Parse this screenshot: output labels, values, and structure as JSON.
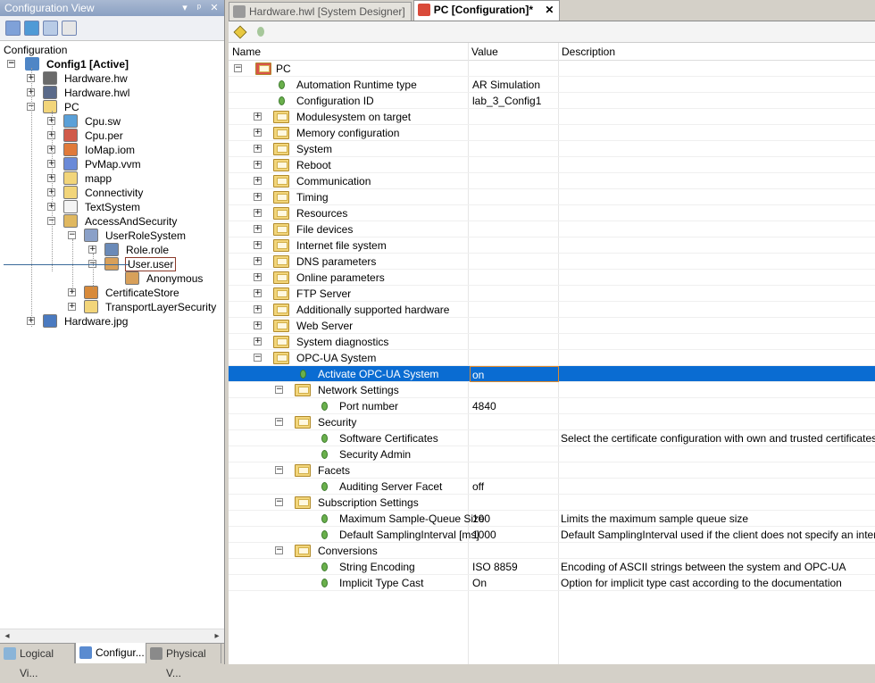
{
  "left_panel": {
    "title": "Configuration View",
    "title_buttons": [
      "▾",
      "ᵖ",
      "✕"
    ],
    "section_label": "Configuration",
    "root": "Config1 [Active]",
    "tree": [
      {
        "label": "Hardware.hw",
        "icon": "hardware-icon"
      },
      {
        "label": "Hardware.hwl",
        "icon": "hardware-list-icon"
      },
      {
        "label": "PC",
        "icon": "folder-icon"
      },
      {
        "label": "Cpu.sw",
        "icon": "software-icon"
      },
      {
        "label": "Cpu.per",
        "icon": "permission-icon"
      },
      {
        "label": "IoMap.iom",
        "icon": "iomap-icon"
      },
      {
        "label": "PvMap.vvm",
        "icon": "pvmap-icon"
      },
      {
        "label": "mapp",
        "icon": "folder-icon"
      },
      {
        "label": "Connectivity",
        "icon": "folder-icon"
      },
      {
        "label": "TextSystem",
        "icon": "text-icon"
      },
      {
        "label": "AccessAndSecurity",
        "icon": "shield-folder-icon"
      },
      {
        "label": "UserRoleSystem",
        "icon": "user-role-folder-icon"
      },
      {
        "label": "Role.role",
        "icon": "role-icon"
      },
      {
        "label": "User.user",
        "icon": "user-icon"
      },
      {
        "label": "Anonymous",
        "icon": "user-icon"
      },
      {
        "label": "CertificateStore",
        "icon": "certificate-icon"
      },
      {
        "label": "TransportLayerSecurity",
        "icon": "folder-icon"
      },
      {
        "label": "Hardware.jpg",
        "icon": "image-icon"
      }
    ],
    "bottom_tabs": [
      "Logical Vi...",
      "Configur...",
      "Physical V..."
    ]
  },
  "document_tabs": [
    {
      "label": "Hardware.hwl [System Designer]",
      "active": false
    },
    {
      "label": "PC [Configuration]*",
      "active": true,
      "close": "✕"
    }
  ],
  "grid": {
    "columns": [
      "Name",
      "Value",
      "Description"
    ],
    "root": "PC",
    "rows": [
      {
        "name": "Automation Runtime type",
        "value": "AR Simulation",
        "desc": "",
        "kind": "leaf",
        "level": 1
      },
      {
        "name": "Configuration ID",
        "value": "lab_3_Config1",
        "desc": "",
        "kind": "leaf",
        "level": 1
      },
      {
        "name": "Modulesystem on target",
        "value": "",
        "desc": "",
        "kind": "folder",
        "level": 1
      },
      {
        "name": "Memory configuration",
        "value": "",
        "desc": "",
        "kind": "folder",
        "level": 1
      },
      {
        "name": "System",
        "value": "",
        "desc": "",
        "kind": "folder",
        "level": 1
      },
      {
        "name": "Reboot",
        "value": "",
        "desc": "",
        "kind": "folder",
        "level": 1
      },
      {
        "name": "Communication",
        "value": "",
        "desc": "",
        "kind": "folder",
        "level": 1
      },
      {
        "name": "Timing",
        "value": "",
        "desc": "",
        "kind": "folder",
        "level": 1
      },
      {
        "name": "Resources",
        "value": "",
        "desc": "",
        "kind": "folder",
        "level": 1
      },
      {
        "name": "File devices",
        "value": "",
        "desc": "",
        "kind": "folder",
        "level": 1
      },
      {
        "name": "Internet file system",
        "value": "",
        "desc": "",
        "kind": "folder",
        "level": 1
      },
      {
        "name": "DNS parameters",
        "value": "",
        "desc": "",
        "kind": "folder",
        "level": 1
      },
      {
        "name": "Online parameters",
        "value": "",
        "desc": "",
        "kind": "folder",
        "level": 1
      },
      {
        "name": "FTP Server",
        "value": "",
        "desc": "",
        "kind": "folder",
        "level": 1
      },
      {
        "name": "Additionally supported hardware",
        "value": "",
        "desc": "",
        "kind": "folder",
        "level": 1
      },
      {
        "name": "Web Server",
        "value": "",
        "desc": "",
        "kind": "folder",
        "level": 1
      },
      {
        "name": "System diagnostics",
        "value": "",
        "desc": "",
        "kind": "folder",
        "level": 1
      },
      {
        "name": "OPC-UA System",
        "value": "",
        "desc": "",
        "kind": "folder-open",
        "level": 1
      },
      {
        "name": "Activate OPC-UA System",
        "value": "on",
        "desc": "",
        "kind": "leaf",
        "level": 2,
        "selected": true
      },
      {
        "name": "Network Settings",
        "value": "",
        "desc": "",
        "kind": "folder-open",
        "level": 2
      },
      {
        "name": "Port number",
        "value": "4840",
        "desc": "",
        "kind": "leaf",
        "level": 3
      },
      {
        "name": "Security",
        "value": "",
        "desc": "",
        "kind": "folder-open",
        "level": 2
      },
      {
        "name": "Software Certificates",
        "value": "",
        "desc": "Select the certificate configuration with own and trusted certificates",
        "kind": "leaf",
        "level": 3
      },
      {
        "name": "Security Admin",
        "value": "",
        "desc": "",
        "kind": "leaf",
        "level": 3
      },
      {
        "name": "Facets",
        "value": "",
        "desc": "",
        "kind": "folder-open",
        "level": 2
      },
      {
        "name": "Auditing Server Facet",
        "value": "off",
        "desc": "",
        "kind": "leaf",
        "level": 3
      },
      {
        "name": "Subscription Settings",
        "value": "",
        "desc": "",
        "kind": "folder-open",
        "level": 2
      },
      {
        "name": "Maximum Sample-Queue Size",
        "value": "100",
        "desc": "Limits the maximum sample queue size",
        "kind": "leaf",
        "level": 3
      },
      {
        "name": "Default SamplingInterval [ms]",
        "value": "1000",
        "desc": "Default SamplingInterval used if the client does not specify an interval",
        "kind": "leaf",
        "level": 3
      },
      {
        "name": "Conversions",
        "value": "",
        "desc": "",
        "kind": "folder-open",
        "level": 2
      },
      {
        "name": "String Encoding",
        "value": "ISO 8859",
        "desc": "Encoding of ASCII strings between the system and OPC-UA",
        "kind": "leaf",
        "level": 3
      },
      {
        "name": "Implicit Type Cast",
        "value": "On",
        "desc": "Option for implicit type cast according to the documentation",
        "kind": "leaf",
        "level": 3
      }
    ]
  },
  "colors": {
    "selection": "#0a6cd2",
    "title_bar": "#8aa0c2",
    "folder": "#f2d57a",
    "leaf": "#6ab04c"
  }
}
